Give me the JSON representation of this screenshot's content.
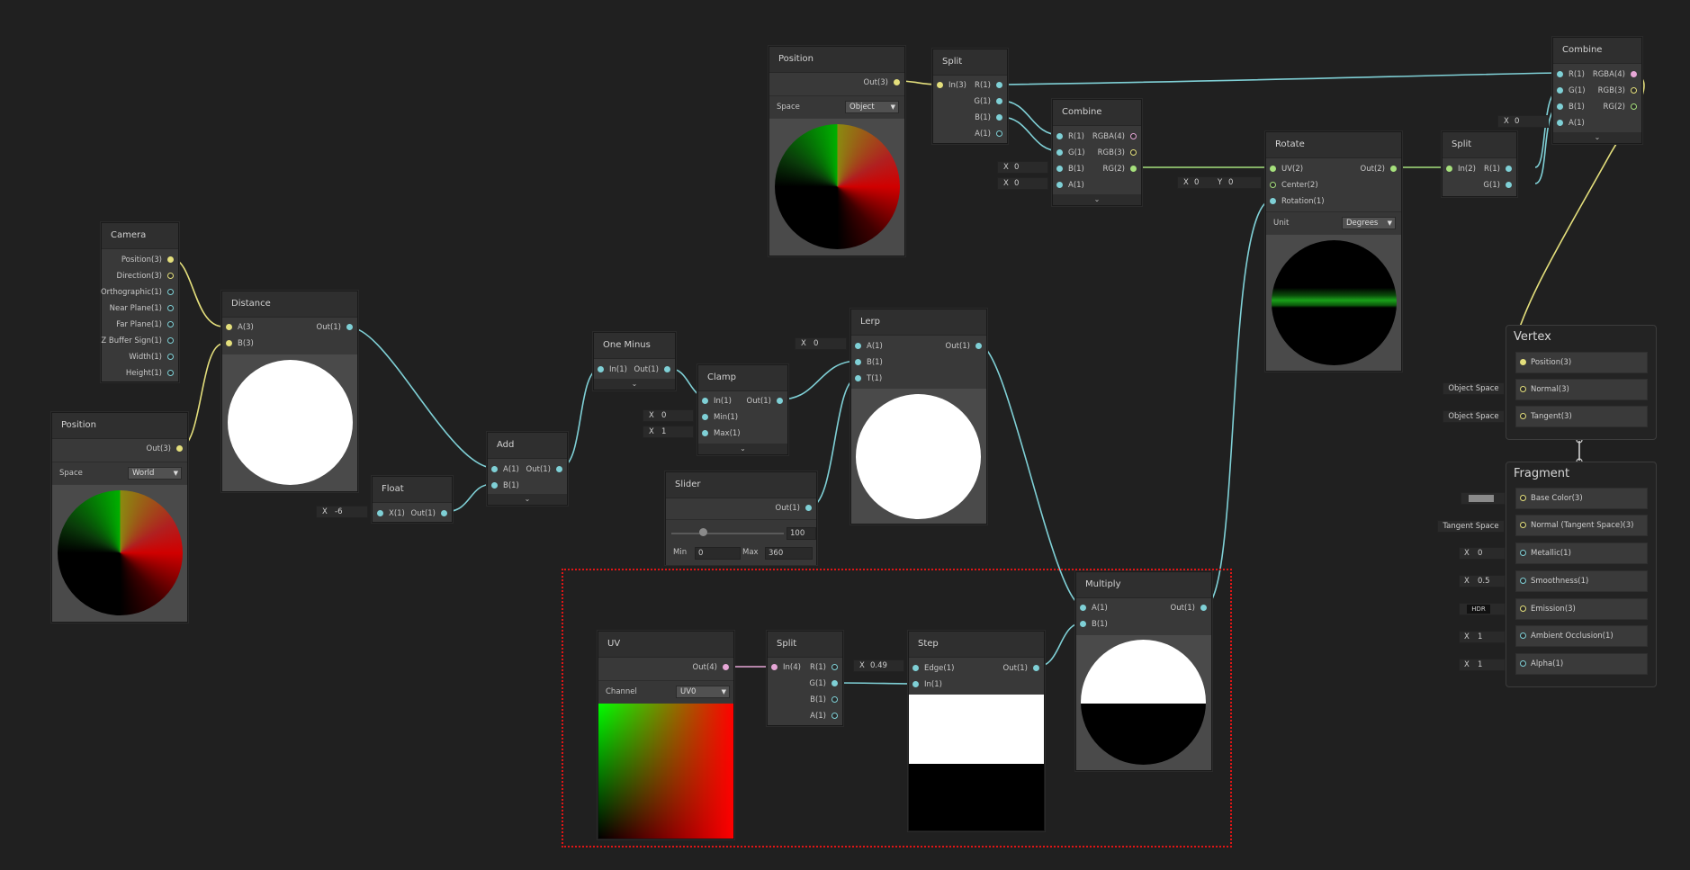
{
  "nodes": {
    "camera": {
      "title": "Camera",
      "outputs": [
        "Position(3)",
        "Direction(3)",
        "Orthographic(1)",
        "Near Plane(1)",
        "Far Plane(1)",
        "Z Buffer Sign(1)",
        "Width(1)",
        "Height(1)"
      ]
    },
    "position_world": {
      "title": "Position",
      "out": "Out(3)",
      "space_label": "Space",
      "space_value": "World"
    },
    "distance": {
      "title": "Distance",
      "in_a": "A(3)",
      "in_b": "B(3)",
      "out": "Out(1)"
    },
    "float": {
      "title": "Float",
      "in": "X(1)",
      "out": "Out(1)",
      "x_label": "X",
      "x_value": "-6"
    },
    "add": {
      "title": "Add",
      "in_a": "A(1)",
      "in_b": "B(1)",
      "out": "Out(1)"
    },
    "one_minus": {
      "title": "One Minus",
      "in": "In(1)",
      "out": "Out(1)"
    },
    "clamp": {
      "title": "Clamp",
      "in": "In(1)",
      "min": "Min(1)",
      "max": "Max(1)",
      "out": "Out(1)",
      "min_label": "X",
      "min_value": "0",
      "max_label": "X",
      "max_value": "1"
    },
    "slider": {
      "title": "Slider",
      "out": "Out(1)",
      "value": "100",
      "min_label": "Min",
      "min_value": "0",
      "max_label": "Max",
      "max_value": "360",
      "level": 0.28
    },
    "lerp": {
      "title": "Lerp",
      "in_a": "A(1)",
      "in_b": "B(1)",
      "in_t": "T(1)",
      "out": "Out(1)",
      "a_label": "X",
      "a_value": "0"
    },
    "position_object": {
      "title": "Position",
      "out": "Out(3)",
      "space_label": "Space",
      "space_value": "Object"
    },
    "split_top": {
      "title": "Split",
      "in": "In(3)",
      "outs": [
        "R(1)",
        "G(1)",
        "B(1)",
        "A(1)"
      ]
    },
    "combine_mid": {
      "title": "Combine",
      "ins": [
        "R(1)",
        "G(1)",
        "B(1)",
        "A(1)"
      ],
      "outs": [
        "RGBA(4)",
        "RGB(3)",
        "RG(2)"
      ],
      "b_label": "X",
      "b_value": "0",
      "a_label": "X",
      "a_value": "0"
    },
    "rotate": {
      "title": "Rotate",
      "ins": [
        "UV(2)",
        "Center(2)",
        "Rotation(1)"
      ],
      "out": "Out(2)",
      "unit_label": "Unit",
      "unit_value": "Degrees",
      "cx_label": "X",
      "cx_value": "0",
      "cy_label": "Y",
      "cy_value": "0"
    },
    "split_right": {
      "title": "Split",
      "in": "In(2)",
      "outs": [
        "R(1)",
        "G(1)"
      ]
    },
    "combine_right": {
      "title": "Combine",
      "ins": [
        "R(1)",
        "G(1)",
        "B(1)",
        "A(1)"
      ],
      "outs": [
        "RGBA(4)",
        "RGB(3)",
        "RG(2)"
      ],
      "a_label": "X",
      "a_value": "0"
    },
    "multiply": {
      "title": "Multiply",
      "in_a": "A(1)",
      "in_b": "B(1)",
      "out": "Out(1)"
    },
    "uv": {
      "title": "UV",
      "out": "Out(4)",
      "channel_label": "Channel",
      "channel_value": "UV0"
    },
    "split_bottom": {
      "title": "Split",
      "in": "In(4)",
      "outs": [
        "R(1)",
        "G(1)",
        "B(1)",
        "A(1)"
      ]
    },
    "step": {
      "title": "Step",
      "in_edge": "Edge(1)",
      "in_in": "In(1)",
      "out": "Out(1)",
      "edge_label": "X",
      "edge_value": "0.49"
    }
  },
  "vertex": {
    "title": "Vertex",
    "rows": [
      "Position(3)",
      "Normal(3)",
      "Tangent(3)"
    ],
    "normal_space": "Object Space",
    "tangent_space": "Object Space"
  },
  "fragment": {
    "title": "Fragment",
    "rows": [
      "Base Color(3)",
      "Normal (Tangent Space)(3)",
      "Metallic(1)",
      "Smoothness(1)",
      "Emission(3)",
      "Ambient Occlusion(1)",
      "Alpha(1)"
    ],
    "normal_space": "Tangent Space",
    "hdr": "HDR",
    "metallic_label": "X",
    "metallic_value": "0",
    "smooth_label": "X",
    "smooth_value": "0.5",
    "ao_label": "X",
    "ao_value": "1",
    "alpha_label": "X",
    "alpha_value": "1"
  },
  "colors": {
    "float_wire": "#7fd0d6",
    "vec3_wire": "#e4df7c",
    "vec2_wire": "#a6e07c",
    "vec4_wire": "#e6a6d6",
    "selection": "#e01515"
  }
}
